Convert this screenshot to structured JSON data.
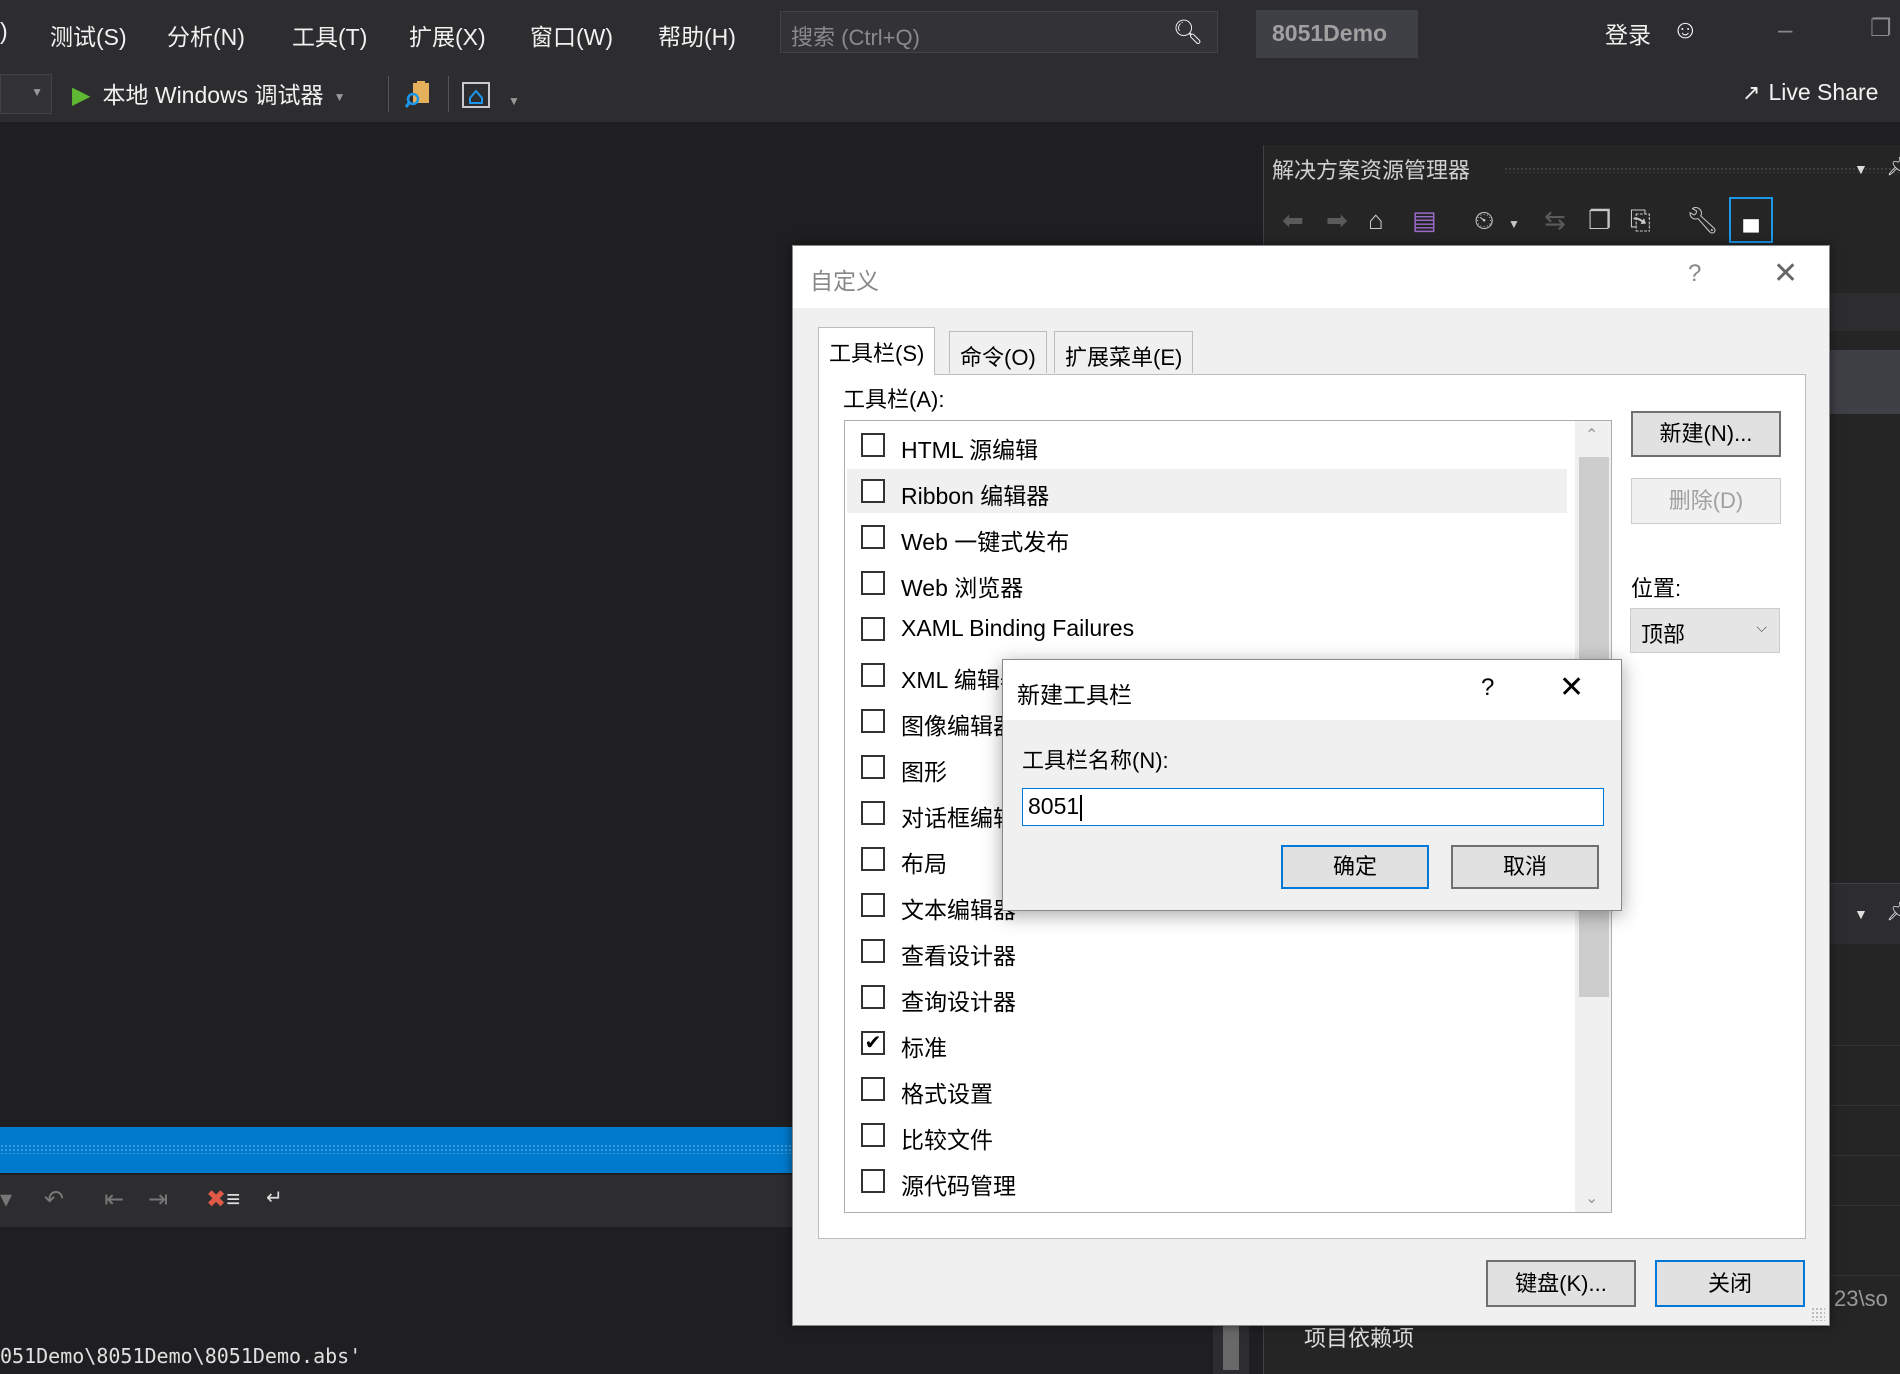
{
  "menubar": {
    "partial_item": ")",
    "items": [
      "测试(S)",
      "分析(N)",
      "工具(T)",
      "扩展(X)",
      "窗口(W)",
      "帮助(H)"
    ],
    "search_placeholder": "搜索 (Ctrl+Q)",
    "solution_name": "8051Demo",
    "login_label": "登录"
  },
  "toolbar": {
    "run_label": "本地 Windows 调试器",
    "live_share_label": "Live Share"
  },
  "solution_explorer": {
    "title": "解决方案资源管理器",
    "path_fragment": "23\\so",
    "project_dependencies": "项目依赖项"
  },
  "output": {
    "path_text": "051Demo\\8051Demo\\8051Demo.abs'"
  },
  "customize_dialog": {
    "title": "自定义",
    "help": "?",
    "tabs": [
      "工具栏(S)",
      "命令(O)",
      "扩展菜单(E)"
    ],
    "active_tab": 0,
    "toolbars_label": "工具栏(A):",
    "toolbars": [
      {
        "label": "HTML 源编辑",
        "checked": false
      },
      {
        "label": "Ribbon 编辑器",
        "checked": false
      },
      {
        "label": "Web 一键式发布",
        "checked": false
      },
      {
        "label": "Web 浏览器",
        "checked": false
      },
      {
        "label": "XAML Binding Failures",
        "checked": false
      },
      {
        "label": "XML 编辑器",
        "checked": false
      },
      {
        "label": "图像编辑器",
        "checked": false
      },
      {
        "label": "图形",
        "checked": false
      },
      {
        "label": "对话框编辑器",
        "checked": false
      },
      {
        "label": "布局",
        "checked": false
      },
      {
        "label": "文本编辑器",
        "checked": false
      },
      {
        "label": "查看设计器",
        "checked": false
      },
      {
        "label": "查询设计器",
        "checked": false
      },
      {
        "label": "标准",
        "checked": true
      },
      {
        "label": "格式设置",
        "checked": false
      },
      {
        "label": "比较文件",
        "checked": false
      },
      {
        "label": "源代码管理",
        "checked": false
      }
    ],
    "new_button": "新建(N)...",
    "delete_button": "删除(D)",
    "position_label": "位置:",
    "position_value": "顶部",
    "keyboard_button": "键盘(K)...",
    "close_button": "关闭"
  },
  "new_toolbar_dialog": {
    "title": "新建工具栏",
    "help": "?",
    "name_label": "工具栏名称(N):",
    "name_value": "8051",
    "ok_button": "确定",
    "cancel_button": "取消"
  }
}
